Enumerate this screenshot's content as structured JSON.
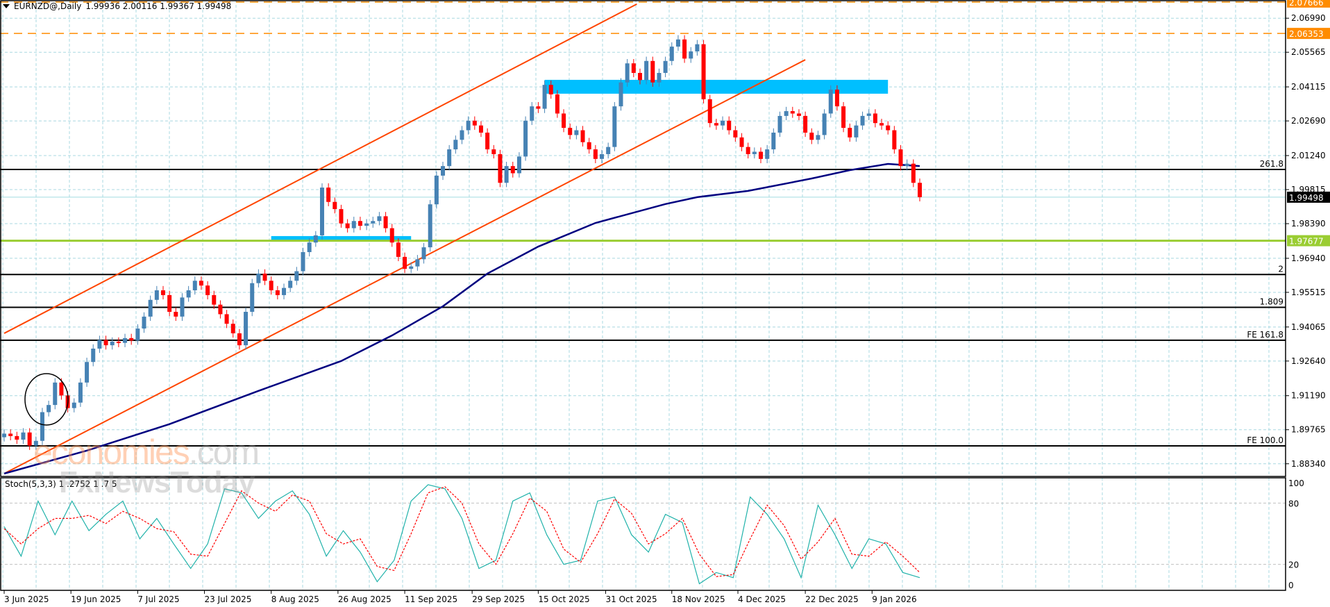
{
  "header": {
    "symbol": "EURNZD@,Daily",
    "ohlc": "1.99936 2.00116 1.99367 1.99498"
  },
  "stoch_header": {
    "label": "Stoch(5,3,3)",
    "values": "1 .2752 1 .7 5"
  },
  "watermark": {
    "part1": "economies",
    "part2": ".com",
    "part3": "FxNewsToday"
  },
  "colors": {
    "bull": "#4682b4",
    "bear": "#ff0000",
    "ma": "#000080",
    "channel": "#ff4500",
    "zone": "#00bfff",
    "support": "#9acd32",
    "resistance": "#ff8c00",
    "grid": "#a8d8e0",
    "stoch_k": "#20b2aa",
    "stoch_d": "#ff0000"
  },
  "chart_data": {
    "type": "candlestick",
    "title": "EURNZD@,Daily",
    "ylim": [
      1.8781,
      2.0775
    ],
    "y_tick_labels": [
      "2.06990",
      "2.05565",
      "2.04115",
      "2.02690",
      "2.01240",
      "1.99815",
      "1.98390",
      "1.96940",
      "1.95515",
      "1.94065",
      "1.92640",
      "1.91190",
      "1.89765",
      "1.88340"
    ],
    "x_tick_labels": [
      {
        "label": "3 Jun 2025",
        "index": 0
      },
      {
        "label": "19 Jun 2025",
        "index": 10.5
      },
      {
        "label": "7 Jul 2025",
        "index": 21
      },
      {
        "label": "23 Jul 2025",
        "index": 31.5
      },
      {
        "label": "8 Aug 2025",
        "index": 42
      },
      {
        "label": "26 Aug 2025",
        "index": 52.5
      },
      {
        "label": "11 Sep 2025",
        "index": 63
      },
      {
        "label": "29 Sep 2025",
        "index": 73.6
      },
      {
        "label": "15 Oct 2025",
        "index": 84
      },
      {
        "label": "31 Oct 2025",
        "index": 94.6
      },
      {
        "label": "18 Nov 2025",
        "index": 105
      },
      {
        "label": "4 Dec 2025",
        "index": 115.4
      },
      {
        "label": "22 Dec 2025",
        "index": 126
      },
      {
        "label": "9 Jan 2026",
        "index": 136.5
      }
    ],
    "first_open": 1.8945,
    "close": [
      1.896,
      1.895,
      1.8935,
      1.8965,
      1.891,
      1.893,
      1.905,
      1.908,
      1.9174,
      1.912,
      1.9067,
      1.909,
      1.9174,
      1.926,
      1.9316,
      1.9352,
      1.933,
      1.9345,
      1.934,
      1.936,
      1.935,
      1.94,
      1.945,
      1.952,
      1.956,
      1.954,
      1.947,
      1.945,
      1.953,
      1.956,
      1.96,
      1.958,
      1.954,
      1.95,
      1.946,
      1.942,
      1.938,
      1.933,
      1.947,
      1.959,
      1.963,
      1.96,
      1.956,
      1.954,
      1.957,
      1.96,
      1.964,
      1.972,
      1.976,
      1.979,
      1.999,
      1.993,
      1.99,
      1.984,
      1.982,
      1.985,
      1.983,
      1.984,
      1.985,
      1.987,
      1.982,
      1.976,
      1.97,
      1.965,
      1.966,
      1.969,
      1.974,
      1.992,
      2.004,
      2.008,
      2.015,
      2.019,
      2.023,
      2.027,
      2.025,
      2.022,
      2.015,
      2.013,
      2.001,
      2.008,
      2.005,
      2.012,
      2.027,
      2.033,
      2.032,
      2.042,
      2.038,
      2.03,
      2.024,
      2.021,
      2.023,
      2.018,
      2.015,
      2.011,
      2.013,
      2.016,
      2.033,
      2.043,
      2.051,
      2.047,
      2.044,
      2.052,
      2.043,
      2.047,
      2.052,
      2.058,
      2.061,
      2.053,
      2.056,
      2.059,
      2.036,
      2.026,
      2.025,
      2.027,
      2.023,
      2.02,
      2.016,
      2.013,
      2.014,
      2.011,
      2.015,
      2.022,
      2.029,
      2.031,
      2.03,
      2.029,
      2.022,
      2.019,
      2.021,
      2.03,
      2.04,
      2.033,
      2.024,
      2.02,
      2.025,
      2.029,
      2.03,
      2.026,
      2.025,
      2.023,
      2.015,
      2.008,
      2.009,
      2.001,
      1.995
    ],
    "wick": 0.0018,
    "moving_average": [
      [
        0,
        1.8793
      ],
      [
        13,
        1.8889
      ],
      [
        26,
        1.9
      ],
      [
        40,
        1.9139
      ],
      [
        53,
        1.9264
      ],
      [
        61,
        1.9371
      ],
      [
        69,
        1.9493
      ],
      [
        76,
        1.963
      ],
      [
        84,
        1.9743
      ],
      [
        93,
        1.9842
      ],
      [
        104,
        1.9921
      ],
      [
        109,
        1.995
      ],
      [
        117,
        1.9976
      ],
      [
        127,
        2.0028
      ],
      [
        133,
        2.0063
      ],
      [
        139,
        2.0089
      ],
      [
        144,
        2.008
      ]
    ],
    "trendlines": [
      {
        "name": "channel-upper",
        "from": [
          0,
          1.938
        ],
        "to": [
          99.5,
          2.0758
        ]
      },
      {
        "name": "channel-lower",
        "from": [
          0,
          1.8793
        ],
        "to": [
          126,
          2.0525
        ]
      }
    ],
    "zones": [
      {
        "name": "resistance-zone",
        "from_index": 85,
        "to_index": 139,
        "top": 2.0441,
        "bottom": 2.0383
      },
      {
        "name": "breakout-zone",
        "from_index": 42,
        "to_index": 64,
        "top": 1.9787,
        "bottom": 1.9764
      }
    ],
    "levels": [
      {
        "name": "resistance-2",
        "price": 2.07666,
        "label": "2.07666",
        "style": "dashed-orange"
      },
      {
        "name": "resistance-1",
        "price": 2.06353,
        "label": "2.06353",
        "style": "dashed-orange"
      },
      {
        "name": "fib-261-8",
        "price": 2.0066,
        "tag": "261.8",
        "style": "black"
      },
      {
        "name": "current-price",
        "price": 1.99498,
        "label": "1.99498",
        "style": "bid"
      },
      {
        "name": "support",
        "price": 1.97677,
        "label": "1.97677",
        "style": "green"
      },
      {
        "name": "fib-2",
        "price": 1.9626,
        "tag": "2",
        "style": "black"
      },
      {
        "name": "fib-1-809",
        "price": 1.9489,
        "tag": "1.809",
        "style": "black"
      },
      {
        "name": "fe-161-8",
        "price": 1.9351,
        "tag": "FE 161.8",
        "style": "black"
      },
      {
        "name": "fe-100",
        "price": 1.8909,
        "tag": "FE 100.0",
        "style": "black"
      }
    ],
    "stochastic": {
      "ylim": [
        0,
        100
      ],
      "tick_labels": [
        "100",
        "80",
        "20",
        "0"
      ],
      "levels": [
        80,
        20
      ],
      "k": [
        57,
        28,
        82,
        49,
        82,
        53,
        69,
        82,
        45,
        65,
        40,
        16,
        40,
        94,
        90,
        65,
        82,
        92,
        69,
        28,
        53,
        32,
        3,
        24,
        82,
        98,
        94,
        65,
        16,
        24,
        82,
        90,
        49,
        20,
        24,
        82,
        86,
        49,
        32,
        69,
        61,
        1,
        12,
        7,
        86,
        69,
        45,
        7,
        78,
        49,
        16,
        45,
        40,
        12,
        7
      ],
      "d": [
        55,
        40,
        55,
        65,
        65,
        68,
        60,
        72,
        65,
        55,
        52,
        30,
        28,
        60,
        92,
        80,
        72,
        88,
        82,
        50,
        40,
        45,
        18,
        14,
        50,
        90,
        96,
        80,
        40,
        20,
        50,
        85,
        72,
        35,
        22,
        50,
        84,
        70,
        40,
        50,
        65,
        30,
        8,
        10,
        45,
        78,
        58,
        25,
        42,
        65,
        30,
        28,
        42,
        28,
        12
      ]
    }
  }
}
